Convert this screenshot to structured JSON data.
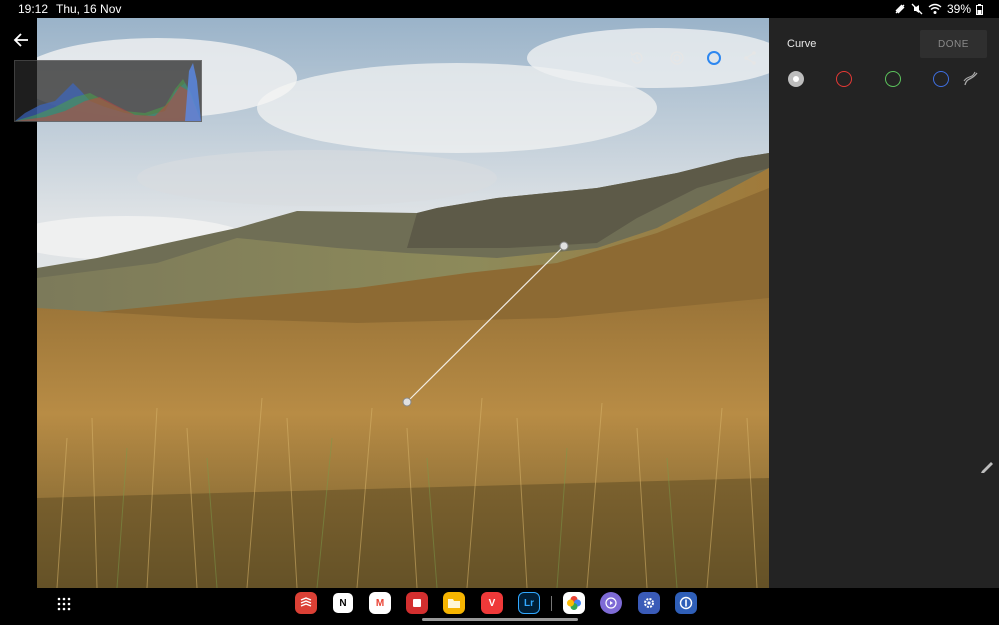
{
  "status": {
    "time": "19:12",
    "date": "Thu, 16 Nov",
    "battery": "39%"
  },
  "panel": {
    "title": "Curve",
    "done_label": "DONE",
    "channels": [
      {
        "name": "luminance",
        "color": "#c8c8c8"
      },
      {
        "name": "red",
        "color": "#e53935"
      },
      {
        "name": "green",
        "color": "#5cc35c"
      },
      {
        "name": "blue",
        "color": "#3f6fe0"
      }
    ]
  },
  "toolbar": {
    "icons": [
      "history-icon",
      "compare-icon",
      "circle-icon",
      "share-icon",
      "more-vertical-icon"
    ]
  },
  "dock": {
    "apps": [
      {
        "name": "todoist",
        "color": "#db4035",
        "glyph": ""
      },
      {
        "name": "notion",
        "color": "#ffffff",
        "glyph": "N"
      },
      {
        "name": "gmail",
        "color": "#ffffff",
        "glyph": "M"
      },
      {
        "name": "red-notes",
        "color": "#d32f2f",
        "glyph": ""
      },
      {
        "name": "files",
        "color": "#f6b400",
        "glyph": ""
      },
      {
        "name": "vivaldi",
        "color": "#ef3939",
        "glyph": "V"
      },
      {
        "name": "lightroom",
        "color": "#001e36",
        "glyph": "Lr"
      },
      {
        "name": "google-photos",
        "color": "#ffffff",
        "glyph": ""
      },
      {
        "name": "video-player",
        "color": "#7e6bd6",
        "glyph": ""
      },
      {
        "name": "settings",
        "color": "#3a5bb8",
        "glyph": ""
      },
      {
        "name": "1password",
        "color": "#2f5fb8",
        "glyph": ""
      }
    ]
  },
  "accent_color": "#2d87f0"
}
